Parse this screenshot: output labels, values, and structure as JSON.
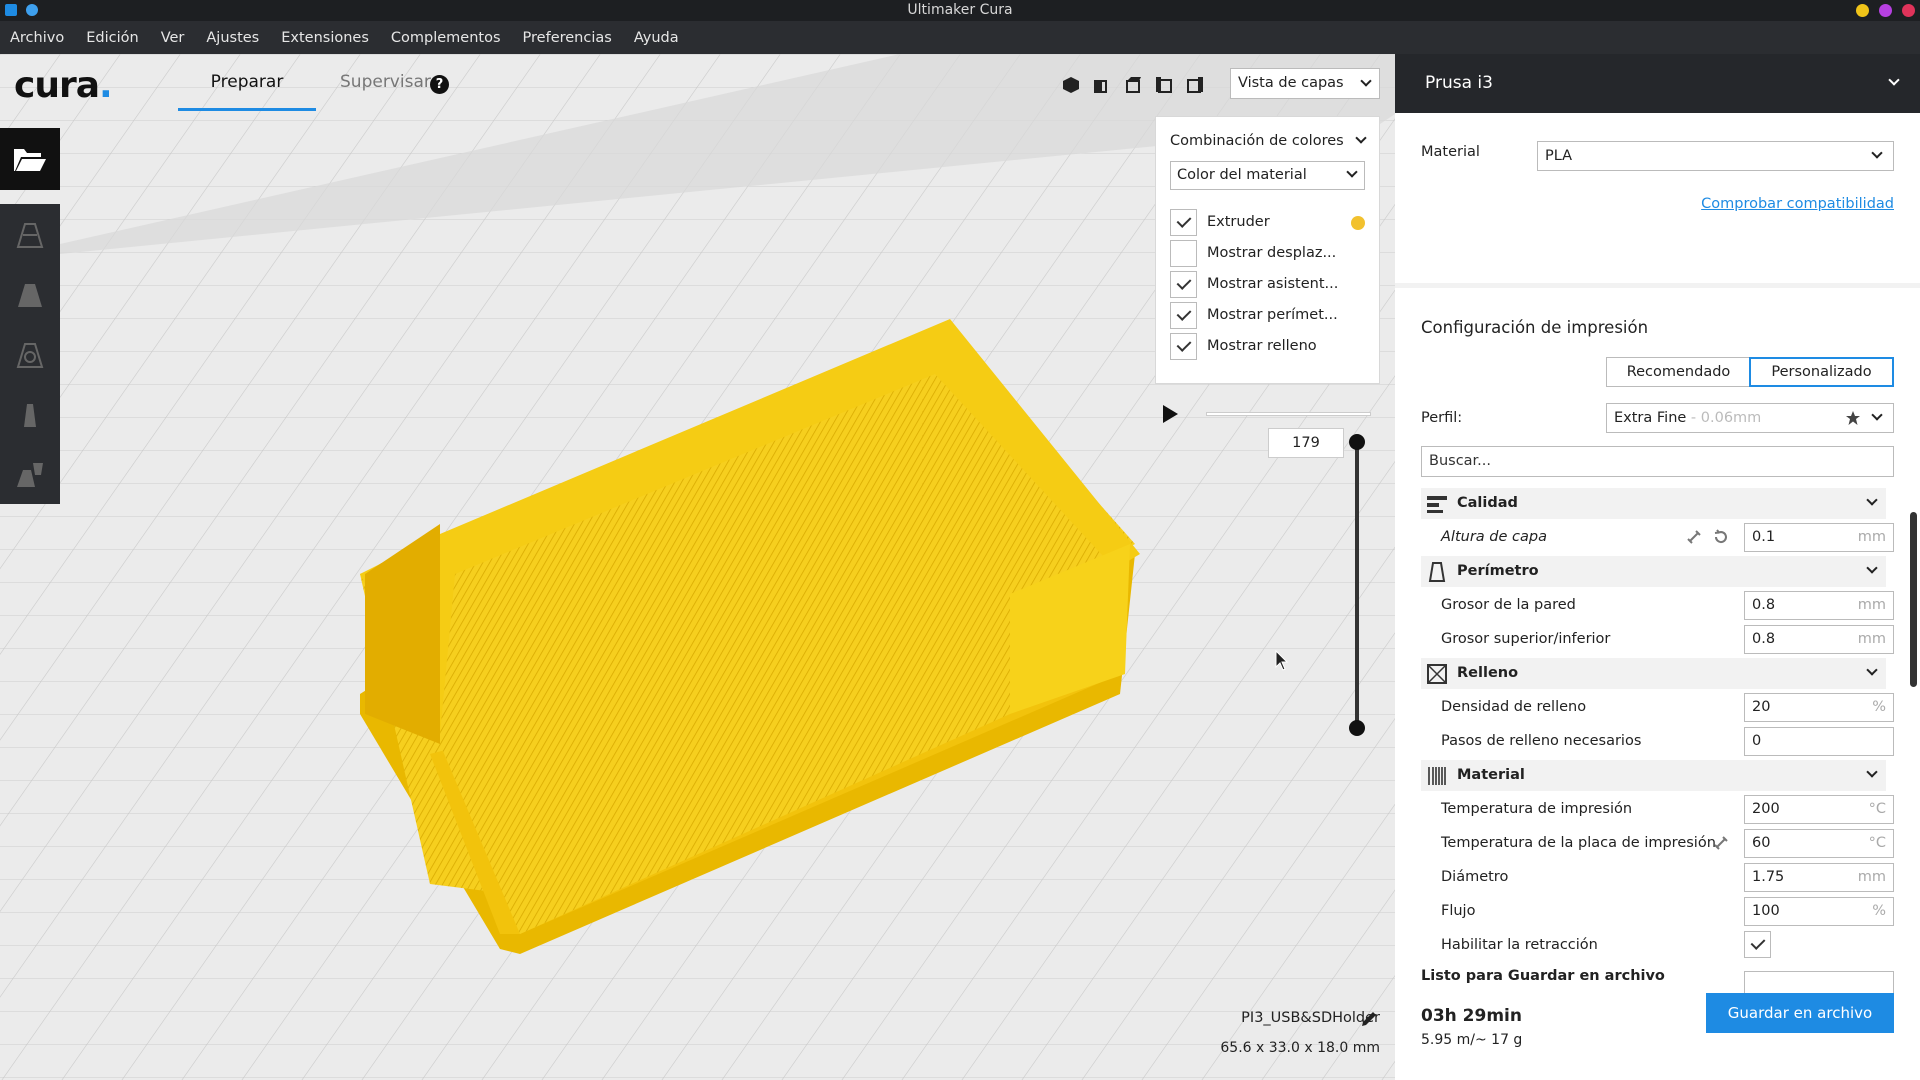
{
  "window": {
    "title": "Ultimaker Cura"
  },
  "menu": [
    "Archivo",
    "Edición",
    "Ver",
    "Ajustes",
    "Extensiones",
    "Complementos",
    "Preferencias",
    "Ayuda"
  ],
  "header": {
    "logo": "cura",
    "tab_prepare": "Preparar",
    "tab_monitor": "Supervisar",
    "view_mode": "Vista de capas"
  },
  "color_panel": {
    "title": "Combinación de colores",
    "scheme": "Color del material",
    "items": [
      {
        "label": "Extruder",
        "checked": true
      },
      {
        "label": "Mostrar desplaz...",
        "checked": false
      },
      {
        "label": "Mostrar asistent...",
        "checked": true
      },
      {
        "label": "Mostrar perímet...",
        "checked": true
      },
      {
        "label": "Mostrar relleno",
        "checked": true
      }
    ],
    "extruder_color": "#f2c12e"
  },
  "layer_slider": {
    "value": "179"
  },
  "model": {
    "name": "PI3_USB&SDHolder",
    "dimensions": "65.6 x 33.0 x 18.0 mm"
  },
  "printer": {
    "name": "Prusa i3"
  },
  "material": {
    "label": "Material",
    "value": "PLA",
    "check_link": "Comprobar compatibilidad"
  },
  "print_settings": {
    "title": "Configuración de impresión",
    "mode_recommended": "Recomendado",
    "mode_custom": "Personalizado",
    "profile_label": "Perfil:",
    "profile_value": "Extra Fine",
    "profile_detail": "- 0.06mm",
    "search_placeholder": "Buscar...",
    "categories": {
      "quality": "Calidad",
      "shell": "Perímetro",
      "infill": "Relleno",
      "material": "Material"
    },
    "settings": {
      "layer_height": {
        "label": "Altura de capa",
        "value": "0.1",
        "unit": "mm"
      },
      "wall_thickness": {
        "label": "Grosor de la pared",
        "value": "0.8",
        "unit": "mm"
      },
      "top_bottom": {
        "label": "Grosor superior/inferior",
        "value": "0.8",
        "unit": "mm"
      },
      "infill_density": {
        "label": "Densidad de relleno",
        "value": "20",
        "unit": "%"
      },
      "infill_steps": {
        "label": "Pasos de relleno necesarios",
        "value": "0"
      },
      "print_temp": {
        "label": "Temperatura de impresión",
        "value": "200",
        "unit": "°C"
      },
      "bed_temp": {
        "label": "Temperatura de la placa de impresión",
        "value": "60",
        "unit": "°C"
      },
      "diameter": {
        "label": "Diámetro",
        "value": "1.75",
        "unit": "mm"
      },
      "flow": {
        "label": "Flujo",
        "value": "100",
        "unit": "%"
      },
      "retraction": {
        "label": "Habilitar la retracción",
        "checked": true
      }
    }
  },
  "footer": {
    "ready": "Listo para Guardar en archivo",
    "time": "03h 29min",
    "material_usage": "5.95 m/~ 17 g",
    "save_button": "Guardar en archivo"
  },
  "colors": {
    "accent": "#1e8be3",
    "filament": "#f2c12e",
    "dark_panel": "#25272b"
  }
}
